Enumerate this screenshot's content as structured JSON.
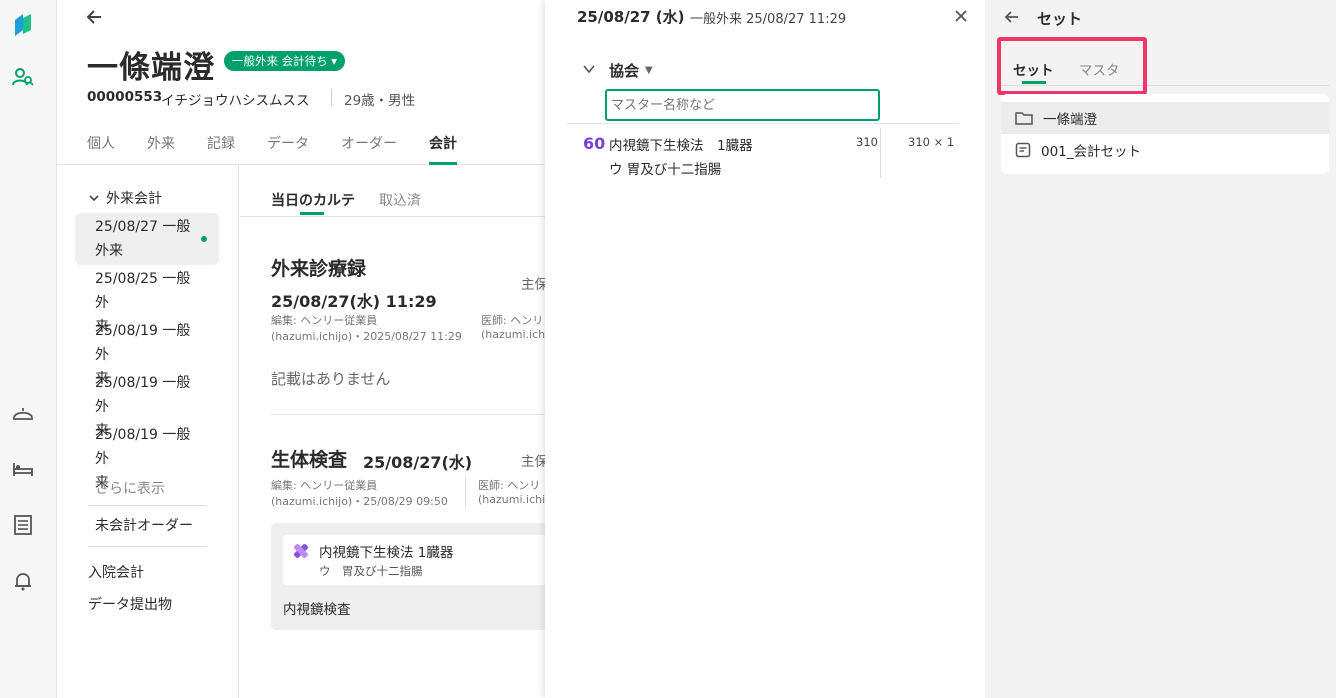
{
  "rail": {
    "icons": [
      "logo-icon",
      "patient-search-icon",
      "reception-bell-icon",
      "bed-icon",
      "list-icon",
      "notification-bell-icon"
    ]
  },
  "patient": {
    "name": "一條端澄",
    "status": "一般外来 会計待ち ▾",
    "id": "00000553",
    "kana": "イチジョウハシスムスス",
    "age_sex": "29歳・男性"
  },
  "tabs": [
    "個人",
    "外来",
    "記録",
    "データ",
    "オーダー",
    "会計"
  ],
  "leftnav": {
    "section": "外来会計",
    "visits": [
      {
        "line1": "25/08/27 一般",
        "line2": "外来"
      },
      {
        "line1": "25/08/25 一般外",
        "line2": "来"
      },
      {
        "line1": "25/08/19 一般外",
        "line2": "来"
      },
      {
        "line1": "25/08/19 一般外",
        "line2": "来"
      },
      {
        "line1": "25/08/19 一般外",
        "line2": "来"
      }
    ],
    "more": "さらに表示",
    "unbilled": "未会計オーダー",
    "inpatient": "入院会計",
    "data_submit": "データ提出物"
  },
  "content": {
    "tabs": [
      "当日のカルテ",
      "取込済"
    ],
    "record_title": "外来診療録",
    "record_right": "主保",
    "record_date": "25/08/27(水) 11:29",
    "record_edit1": "編集: ヘンリー従業員",
    "record_edit2": "(hazumi.ichijo)・2025/08/27 11:29",
    "record_doc1": "医師: ヘンリ",
    "record_doc2": "(hazumi.ichi",
    "record_empty": "記載はありません",
    "exam_title": "生体検査",
    "exam_date": "25/08/27(水)",
    "exam_right": "主保",
    "exam_edit1": "編集: ヘンリー従業員",
    "exam_edit2": "(hazumi.ichijo)・25/08/29 09:50",
    "exam_doc1": "医師: ヘンリ",
    "exam_doc2": "(hazumi.ichi",
    "card_title": "内視鏡下生検法  1臓器",
    "card_sub": "ウ　胃及び十二指腸",
    "card_footer": "内視鏡検査"
  },
  "panel": {
    "date": "25/08/27 (水)",
    "visit": "一般外来 25/08/27 11:29",
    "group": "協会",
    "search_placeholder": "マスター名称など",
    "item": {
      "number": "60",
      "name": "内視鏡下生検法　1臓器",
      "sub": "ウ 胃及び十二指腸",
      "points": "310",
      "calc": "310 × 1"
    }
  },
  "right": {
    "title": "セット",
    "tabs": [
      "セット",
      "マスタ"
    ],
    "rows": [
      {
        "icon": "folder-icon",
        "label": "一條端澄"
      },
      {
        "icon": "set-document-icon",
        "label": "001_会計セット"
      }
    ]
  },
  "colors": {
    "accent": "#00a06a",
    "highlight": "#f0356a",
    "number": "#7b3fd6"
  }
}
